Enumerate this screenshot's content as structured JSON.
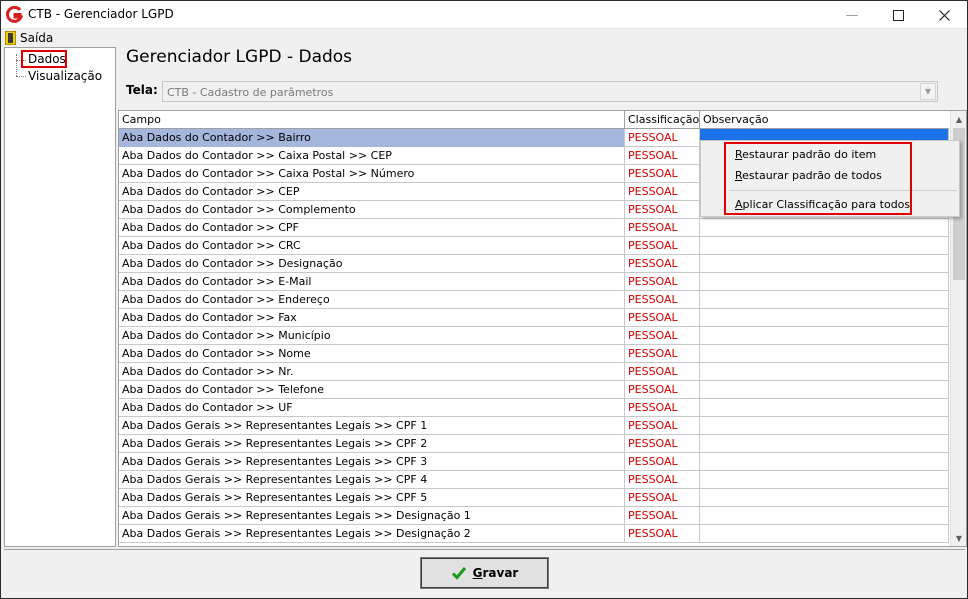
{
  "window": {
    "title": "CTB - Gerenciador LGPD",
    "min_glyph": "—",
    "max_glyph": "☐",
    "close_glyph": "✕"
  },
  "menu": {
    "exit_label": "Saída"
  },
  "tree": {
    "items": [
      "Dados",
      "Visualização"
    ],
    "selected": "Dados"
  },
  "header": {
    "title": "Gerenciador LGPD - Dados"
  },
  "tela": {
    "label": "Tela:",
    "value": "CTB - Cadastro de parâmetros"
  },
  "grid": {
    "columns": [
      "Campo",
      "Classificação",
      "Observação"
    ],
    "rows": [
      {
        "campo": "Aba Dados do Contador >> Bairro",
        "classificacao": "PESSOAL",
        "observacao": ""
      },
      {
        "campo": "Aba Dados do Contador >> Caixa Postal >> CEP",
        "classificacao": "PESSOAL",
        "observacao": ""
      },
      {
        "campo": "Aba Dados do Contador >> Caixa Postal >> Número",
        "classificacao": "PESSOAL",
        "observacao": ""
      },
      {
        "campo": "Aba Dados do Contador >> CEP",
        "classificacao": "PESSOAL",
        "observacao": ""
      },
      {
        "campo": "Aba Dados do Contador >> Complemento",
        "classificacao": "PESSOAL",
        "observacao": ""
      },
      {
        "campo": "Aba Dados do Contador >> CPF",
        "classificacao": "PESSOAL",
        "observacao": ""
      },
      {
        "campo": "Aba Dados do Contador >> CRC",
        "classificacao": "PESSOAL",
        "observacao": ""
      },
      {
        "campo": "Aba Dados do Contador >> Designação",
        "classificacao": "PESSOAL",
        "observacao": ""
      },
      {
        "campo": "Aba Dados do Contador >> E-Mail",
        "classificacao": "PESSOAL",
        "observacao": ""
      },
      {
        "campo": "Aba Dados do Contador >> Endereço",
        "classificacao": "PESSOAL",
        "observacao": ""
      },
      {
        "campo": "Aba Dados do Contador >> Fax",
        "classificacao": "PESSOAL",
        "observacao": ""
      },
      {
        "campo": "Aba Dados do Contador >> Município",
        "classificacao": "PESSOAL",
        "observacao": ""
      },
      {
        "campo": "Aba Dados do Contador >> Nome",
        "classificacao": "PESSOAL",
        "observacao": ""
      },
      {
        "campo": "Aba Dados do Contador >> Nr.",
        "classificacao": "PESSOAL",
        "observacao": ""
      },
      {
        "campo": "Aba Dados do Contador >> Telefone",
        "classificacao": "PESSOAL",
        "observacao": ""
      },
      {
        "campo": "Aba Dados do Contador >> UF",
        "classificacao": "PESSOAL",
        "observacao": ""
      },
      {
        "campo": "Aba Dados Gerais >> Representantes Legais >> CPF 1",
        "classificacao": "PESSOAL",
        "observacao": ""
      },
      {
        "campo": "Aba Dados Gerais >> Representantes Legais >> CPF 2",
        "classificacao": "PESSOAL",
        "observacao": ""
      },
      {
        "campo": "Aba Dados Gerais >> Representantes Legais >> CPF 3",
        "classificacao": "PESSOAL",
        "observacao": ""
      },
      {
        "campo": "Aba Dados Gerais >> Representantes Legais >> CPF 4",
        "classificacao": "PESSOAL",
        "observacao": ""
      },
      {
        "campo": "Aba Dados Gerais >> Representantes Legais >> CPF 5",
        "classificacao": "PESSOAL",
        "observacao": ""
      },
      {
        "campo": "Aba Dados Gerais >> Representantes Legais >> Designação 1",
        "classificacao": "PESSOAL",
        "observacao": ""
      },
      {
        "campo": "Aba Dados Gerais >> Representantes Legais >> Designação 2",
        "classificacao": "PESSOAL",
        "observacao": ""
      }
    ]
  },
  "context_menu": {
    "items": [
      "Restaurar padrão do item",
      "Restaurar padrão de todos",
      "Aplicar Classificação para todos"
    ]
  },
  "footer": {
    "save_label": "Gravar"
  },
  "colors": {
    "classification_text": "#d00000",
    "selected_row": "#a5b6dc",
    "selected_cell": "#1a73e8",
    "highlight_box": "#e00000",
    "check": "#1a9a1a"
  },
  "icons": {
    "app": "app-logo-icon",
    "exit": "door-icon",
    "save": "checkmark-icon"
  }
}
